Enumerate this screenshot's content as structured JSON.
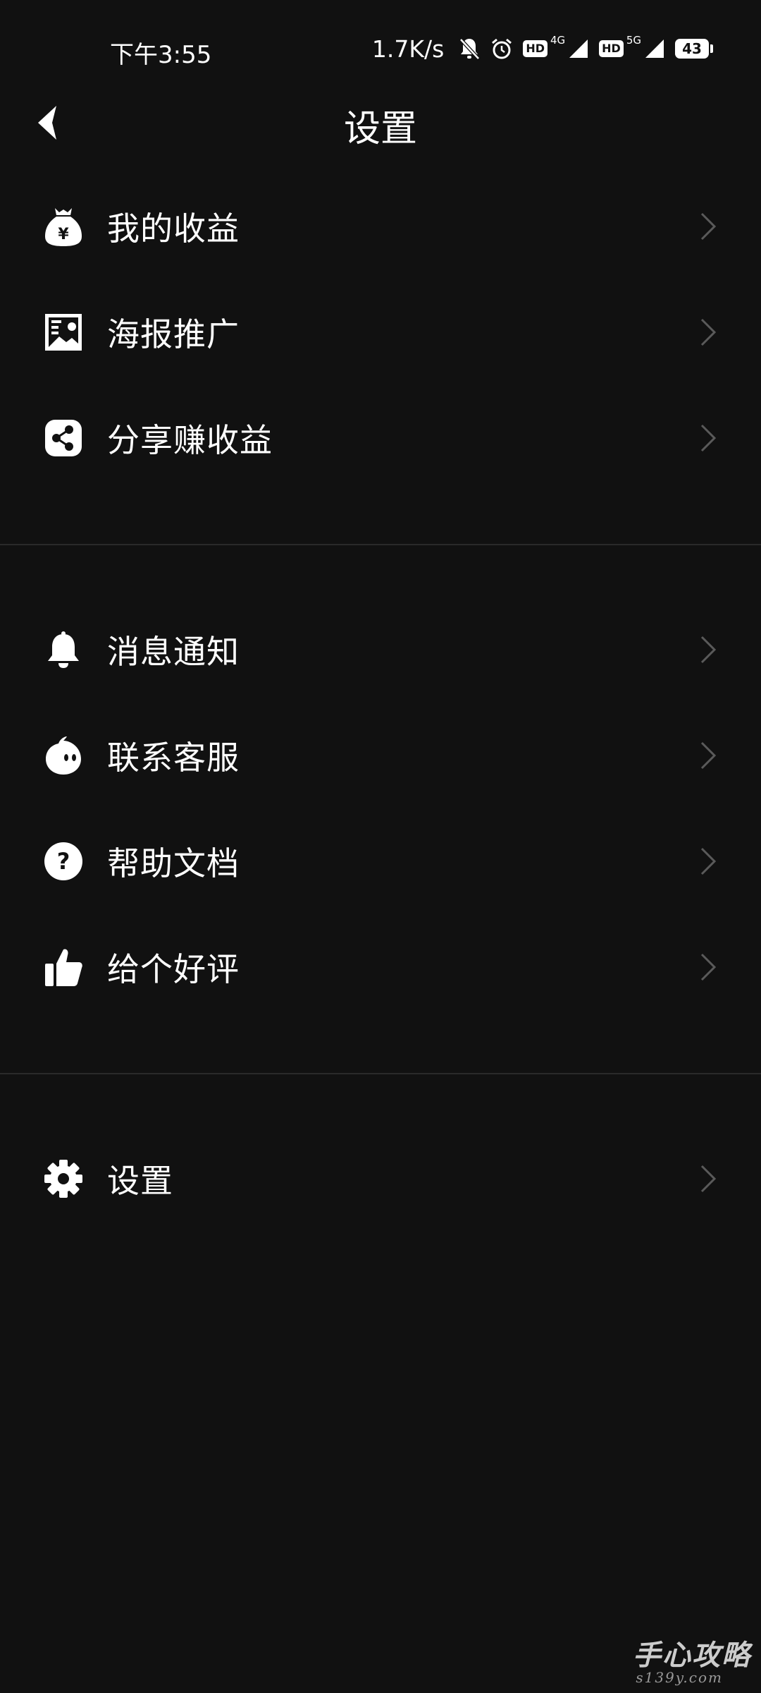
{
  "status_bar": {
    "time": "下午3:55",
    "net_speed": "1.7K/s",
    "sim1": {
      "badge": "HD",
      "type": "4G"
    },
    "sim2": {
      "badge": "HD",
      "type": "5G"
    },
    "battery": "43"
  },
  "header": {
    "title": "设置"
  },
  "menu": {
    "group1": [
      {
        "label": "我的收益",
        "icon": "money-bag-icon"
      },
      {
        "label": "海报推广",
        "icon": "poster-icon"
      },
      {
        "label": "分享赚收益",
        "icon": "share-icon"
      }
    ],
    "group2": [
      {
        "label": "消息通知",
        "icon": "bell-icon"
      },
      {
        "label": "联系客服",
        "icon": "customer-service-icon"
      },
      {
        "label": "帮助文档",
        "icon": "help-icon"
      },
      {
        "label": "给个好评",
        "icon": "thumbs-up-icon"
      }
    ],
    "group3": [
      {
        "label": "设置",
        "icon": "gear-icon"
      }
    ]
  },
  "watermark": {
    "main": "手心攻略",
    "sub": "s139y.com"
  },
  "colors": {
    "background": "#111111",
    "text": "#ffffff",
    "chevron": "#5a5a5a",
    "divider": "#2a2a2a"
  }
}
